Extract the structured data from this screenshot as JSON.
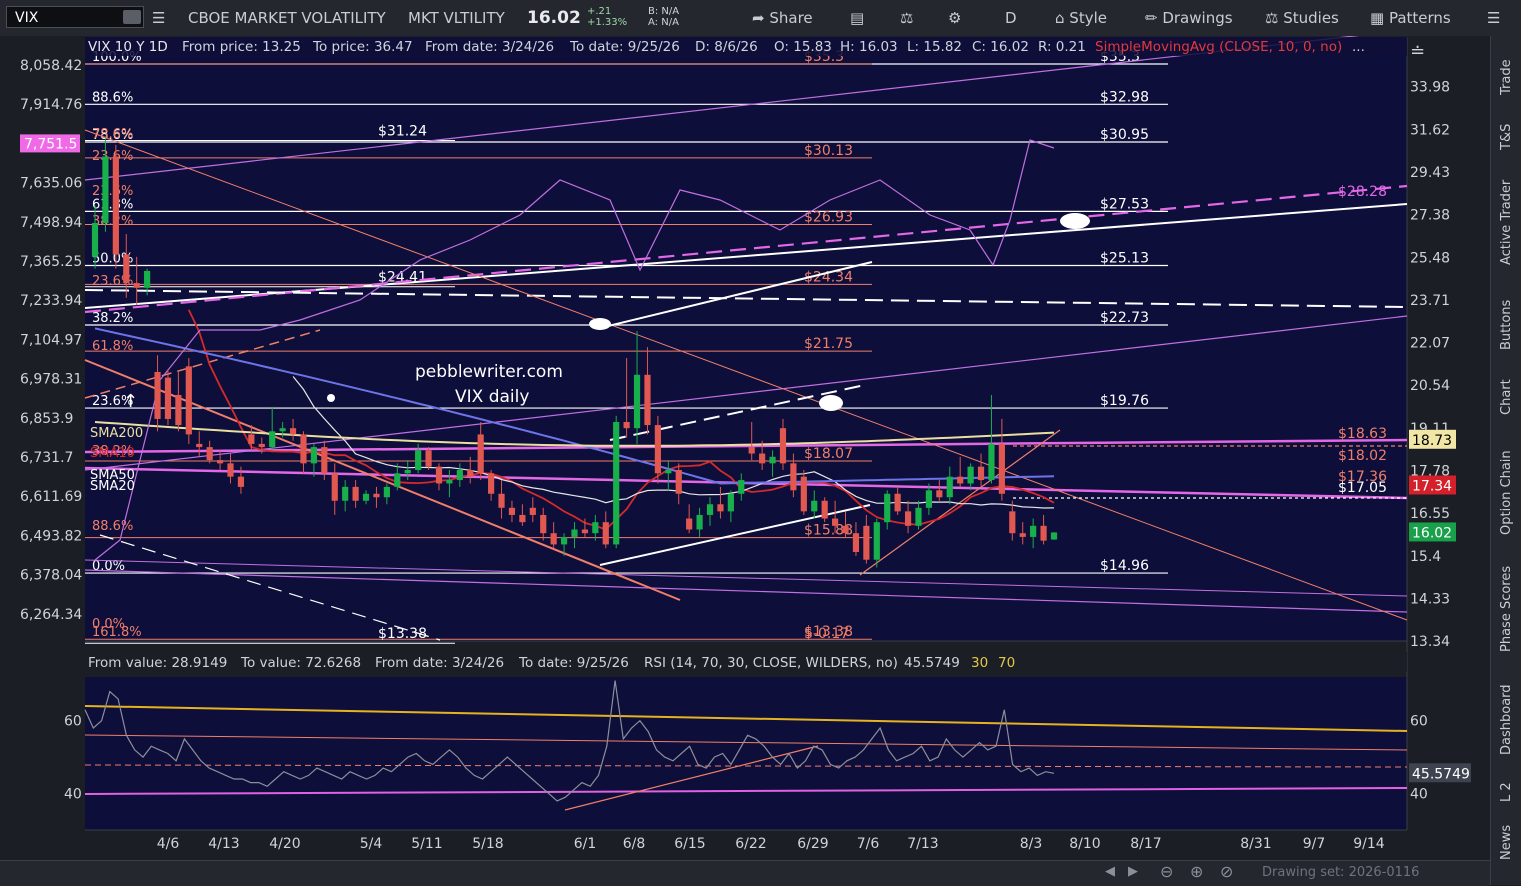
{
  "toolbar": {
    "symbol": "VIX",
    "name": "CBOE MARKET VOLATILITY",
    "short_name": "MKT VLTILITY",
    "last": "16.02",
    "change": "+.21",
    "change_pct": "+1.33%",
    "bid": "B: N/A",
    "ask": "A: N/A",
    "share": "Share",
    "period": "D",
    "style": "Style",
    "drawings": "Drawings",
    "studies": "Studies",
    "patterns": "Patterns"
  },
  "header": {
    "title": "VIX 10 Y 1D",
    "from_price": "From price: 13.25",
    "to_price": "To price: 36.47",
    "from_date": "From date: 3/24/26",
    "to_date": "To date: 9/25/26",
    "bar_date": "D: 8/6/26",
    "open": "O: 15.83",
    "high": "H: 16.03",
    "low": "L: 15.82",
    "close": "C: 16.02",
    "range": "R: 0.21",
    "study": "SimpleMovingAvg (CLOSE, 10, 0, no)",
    "more": "..."
  },
  "rsi_header": {
    "from_value": "From value: 28.9149",
    "to_value": "To value: 72.6268",
    "from_date": "From date: 3/24/26",
    "to_date": "To date: 9/25/26",
    "study": "RSI (14, 70, 30, CLOSE, WILDERS, no)",
    "value": "45.5749",
    "os": "30",
    "ob": "70"
  },
  "side_tabs": [
    "Trade",
    "T&S",
    "Active Trader",
    "Buttons",
    "Chart",
    "Option Chain",
    "Phase Scores",
    "Dashboard",
    "L 2",
    "News"
  ],
  "status": {
    "drawing_set": "Drawing set: 2026-0116"
  },
  "watermark": {
    "line1": "pebblewriter.com",
    "line2": "VIX daily"
  },
  "price_badges": [
    {
      "label": "18.73",
      "value": 18.73,
      "bg": "#f1e6a6",
      "fg": "#000000"
    },
    {
      "label": "17.34",
      "value": 17.34,
      "bg": "#d3202a",
      "fg": "#ffffff"
    },
    {
      "label": "16.02",
      "value": 16.02,
      "bg": "#18a04a",
      "fg": "#ffffff"
    }
  ],
  "left_badge": {
    "label": "7,751.5",
    "bg": "#f06ae8"
  },
  "colors": {
    "background": "#0e0e3a",
    "up": "#18b04a",
    "down": "#e0584f",
    "sma10": "#d32a2a",
    "sma20": "#e6e6e6",
    "sma50": "#6d74e8",
    "sma200": "#e9e0a0",
    "spx": "#c070e0",
    "fib": "#f07f6a",
    "rsi_upper": "#e5b320",
    "rsi_lower": "#e062e0"
  },
  "chart_data": [
    {
      "type": "candlestick",
      "title": "VIX 10 Y 1D",
      "ylim": [
        13.34,
        35.5
      ],
      "right_ticks": [
        "33.98",
        "31.62",
        "29.43",
        "27.38",
        "25.48",
        "23.71",
        "22.07",
        "20.54",
        "19.11",
        "17.78",
        "16.55",
        "15.4",
        "14.33",
        "13.34"
      ],
      "left_ticks": [
        "8,058.42",
        "7,914.76",
        "7,751.5",
        "7,635.06",
        "7,498.94",
        "7,365.25",
        "7,233.94",
        "7,104.97",
        "6,978.31",
        "6,853.9",
        "6,731.7",
        "6,611.69",
        "6,493.82",
        "6,378.04",
        "6,264.34"
      ],
      "x_ticks": [
        "4/6",
        "4/13",
        "4/20",
        "5/4",
        "5/11",
        "5/18",
        "6/1",
        "6/8",
        "6/15",
        "6/22",
        "6/29",
        "7/6",
        "7/13",
        "8/3",
        "8/10",
        "8/17",
        "8/31",
        "9/7",
        "9/14"
      ],
      "fib_left_labels": [
        "100.0%",
        "88.6%",
        "78.6%",
        "61.8%",
        "50.0%",
        "38.2%",
        "23.6%",
        "0.0%"
      ],
      "fib_left_values": [
        35.3,
        32.98,
        30.95,
        27.53,
        25.13,
        22.73,
        19.76,
        14.96
      ],
      "fib_right_labels": [
        "$35.3",
        "$32.98",
        "$30.95",
        "$27.53",
        "$25.13",
        "$22.73",
        "$19.76",
        "$14.96"
      ],
      "fib2_left_labels": [
        "78.6%",
        "23.6%",
        "23.6%",
        "38.2%",
        "23.6%",
        "61.8%",
        "38.2%",
        "88.6%",
        "0.0%",
        "161.8%"
      ],
      "fib2_right_labels": [
        "$35.3",
        "$30.13",
        "$26.93",
        "$24.34",
        "$21.75",
        "$18.07",
        "$15.88",
        "$13.38",
        "$-0.17"
      ],
      "fib2_values": [
        35.3,
        30.13,
        26.93,
        24.34,
        21.75,
        18.07,
        15.88,
        13.38
      ],
      "marks_left": [
        "$31.24",
        "$24.41",
        "$13.38"
      ],
      "mark_values": [
        31.24,
        24.41,
        13.38
      ],
      "right_line_labels": [
        "$28.28",
        "$18.63",
        "$18.02",
        "$17.36",
        "$17.05"
      ],
      "ma_labels": [
        "SMA200",
        "SMA10",
        "SMA50",
        "SMA20"
      ],
      "candles": [
        {
          "o": 25.5,
          "h": 27.8,
          "l": 25.0,
          "c": 27.0
        },
        {
          "o": 27.0,
          "h": 31.2,
          "l": 26.6,
          "c": 30.2
        },
        {
          "o": 30.2,
          "h": 30.8,
          "l": 25.0,
          "c": 25.6
        },
        {
          "o": 25.6,
          "h": 26.5,
          "l": 23.8,
          "c": 24.4
        },
        {
          "o": 24.4,
          "h": 25.5,
          "l": 23.5,
          "c": 24.2
        },
        {
          "o": 24.2,
          "h": 25.0,
          "l": 23.9,
          "c": 24.9
        },
        {
          "o": 21.0,
          "h": 21.6,
          "l": 19.0,
          "c": 19.4
        },
        {
          "o": 20.8,
          "h": 21.1,
          "l": 19.2,
          "c": 19.4
        },
        {
          "o": 20.2,
          "h": 21.0,
          "l": 19.0,
          "c": 19.2
        },
        {
          "o": 21.2,
          "h": 21.5,
          "l": 18.6,
          "c": 18.9
        },
        {
          "o": 18.6,
          "h": 19.0,
          "l": 18.2,
          "c": 18.5
        },
        {
          "o": 18.5,
          "h": 18.7,
          "l": 18.0,
          "c": 18.1
        },
        {
          "o": 18.1,
          "h": 18.4,
          "l": 17.8,
          "c": 18.0
        },
        {
          "o": 18.0,
          "h": 18.3,
          "l": 17.4,
          "c": 17.6
        },
        {
          "o": 17.6,
          "h": 17.9,
          "l": 17.1,
          "c": 17.3
        },
        {
          "o": 18.9,
          "h": 19.2,
          "l": 18.4,
          "c": 18.6
        },
        {
          "o": 18.6,
          "h": 18.8,
          "l": 18.3,
          "c": 18.5
        },
        {
          "o": 18.5,
          "h": 19.8,
          "l": 18.4,
          "c": 19.0
        },
        {
          "o": 19.0,
          "h": 19.3,
          "l": 18.8,
          "c": 19.1
        },
        {
          "o": 19.1,
          "h": 19.4,
          "l": 18.7,
          "c": 18.9
        },
        {
          "o": 18.9,
          "h": 19.0,
          "l": 17.7,
          "c": 18.0
        },
        {
          "o": 18.0,
          "h": 18.6,
          "l": 17.6,
          "c": 18.5
        },
        {
          "o": 18.5,
          "h": 18.7,
          "l": 17.5,
          "c": 17.7
        },
        {
          "o": 17.7,
          "h": 18.0,
          "l": 16.5,
          "c": 16.9
        },
        {
          "o": 16.9,
          "h": 17.5,
          "l": 16.6,
          "c": 17.3
        },
        {
          "o": 17.3,
          "h": 17.5,
          "l": 16.7,
          "c": 16.9
        },
        {
          "o": 16.9,
          "h": 17.2,
          "l": 16.8,
          "c": 17.1
        },
        {
          "o": 17.1,
          "h": 17.3,
          "l": 16.7,
          "c": 17.0
        },
        {
          "o": 17.0,
          "h": 17.4,
          "l": 16.8,
          "c": 17.3
        },
        {
          "o": 17.3,
          "h": 18.0,
          "l": 17.2,
          "c": 17.7
        },
        {
          "o": 17.7,
          "h": 18.1,
          "l": 17.5,
          "c": 17.8
        },
        {
          "o": 17.8,
          "h": 18.6,
          "l": 17.7,
          "c": 18.4
        },
        {
          "o": 18.4,
          "h": 18.5,
          "l": 17.8,
          "c": 17.9
        },
        {
          "o": 17.9,
          "h": 18.0,
          "l": 17.2,
          "c": 17.4
        },
        {
          "o": 17.4,
          "h": 17.8,
          "l": 17.0,
          "c": 17.5
        },
        {
          "o": 17.5,
          "h": 18.0,
          "l": 17.3,
          "c": 17.8
        },
        {
          "o": 17.8,
          "h": 18.2,
          "l": 17.4,
          "c": 17.6
        },
        {
          "o": 18.9,
          "h": 19.3,
          "l": 17.5,
          "c": 17.7
        },
        {
          "o": 17.7,
          "h": 17.8,
          "l": 16.9,
          "c": 17.1
        },
        {
          "o": 17.1,
          "h": 17.5,
          "l": 16.4,
          "c": 16.7
        },
        {
          "o": 16.7,
          "h": 16.9,
          "l": 16.3,
          "c": 16.5
        },
        {
          "o": 16.5,
          "h": 16.8,
          "l": 16.2,
          "c": 16.3
        },
        {
          "o": 16.7,
          "h": 17.0,
          "l": 16.3,
          "c": 16.5
        },
        {
          "o": 16.5,
          "h": 16.7,
          "l": 15.8,
          "c": 16.0
        },
        {
          "o": 16.0,
          "h": 16.3,
          "l": 15.6,
          "c": 15.7
        },
        {
          "o": 15.7,
          "h": 16.0,
          "l": 15.4,
          "c": 15.9
        },
        {
          "o": 15.9,
          "h": 16.3,
          "l": 15.6,
          "c": 16.1
        },
        {
          "o": 16.1,
          "h": 16.4,
          "l": 15.9,
          "c": 16.0
        },
        {
          "o": 16.0,
          "h": 16.5,
          "l": 15.8,
          "c": 16.3
        },
        {
          "o": 16.3,
          "h": 16.6,
          "l": 15.6,
          "c": 15.7
        },
        {
          "o": 15.7,
          "h": 19.5,
          "l": 15.6,
          "c": 19.3
        },
        {
          "o": 19.3,
          "h": 21.5,
          "l": 18.8,
          "c": 19.1
        },
        {
          "o": 19.1,
          "h": 22.5,
          "l": 18.6,
          "c": 20.9
        },
        {
          "o": 20.9,
          "h": 21.9,
          "l": 18.9,
          "c": 19.2
        },
        {
          "o": 19.2,
          "h": 19.5,
          "l": 17.4,
          "c": 17.7
        },
        {
          "o": 17.7,
          "h": 18.1,
          "l": 17.2,
          "c": 17.8
        },
        {
          "o": 17.8,
          "h": 18.0,
          "l": 16.8,
          "c": 17.1
        },
        {
          "o": 16.4,
          "h": 16.8,
          "l": 16.0,
          "c": 16.1
        },
        {
          "o": 16.1,
          "h": 16.7,
          "l": 15.9,
          "c": 16.5
        },
        {
          "o": 16.5,
          "h": 17.0,
          "l": 16.2,
          "c": 16.8
        },
        {
          "o": 16.8,
          "h": 17.3,
          "l": 16.4,
          "c": 16.6
        },
        {
          "o": 16.6,
          "h": 17.2,
          "l": 16.3,
          "c": 17.1
        },
        {
          "o": 17.1,
          "h": 17.7,
          "l": 16.9,
          "c": 17.5
        },
        {
          "o": 18.5,
          "h": 19.3,
          "l": 18.1,
          "c": 18.3
        },
        {
          "o": 18.3,
          "h": 18.7,
          "l": 17.8,
          "c": 18.0
        },
        {
          "o": 18.0,
          "h": 18.4,
          "l": 17.6,
          "c": 18.2
        },
        {
          "o": 19.1,
          "h": 19.4,
          "l": 17.8,
          "c": 18.0
        },
        {
          "o": 18.0,
          "h": 18.3,
          "l": 17.0,
          "c": 17.2
        },
        {
          "o": 17.6,
          "h": 17.8,
          "l": 16.5,
          "c": 16.6
        },
        {
          "o": 16.6,
          "h": 17.2,
          "l": 16.4,
          "c": 16.9
        },
        {
          "o": 16.9,
          "h": 17.0,
          "l": 16.3,
          "c": 16.4
        },
        {
          "o": 16.4,
          "h": 16.9,
          "l": 16.0,
          "c": 16.2
        },
        {
          "o": 16.2,
          "h": 16.6,
          "l": 15.9,
          "c": 16.0
        },
        {
          "o": 16.0,
          "h": 16.3,
          "l": 15.4,
          "c": 15.5
        },
        {
          "o": 16.2,
          "h": 16.5,
          "l": 15.2,
          "c": 15.3
        },
        {
          "o": 15.3,
          "h": 16.4,
          "l": 15.1,
          "c": 16.3
        },
        {
          "o": 16.3,
          "h": 17.2,
          "l": 16.1,
          "c": 17.1
        },
        {
          "o": 17.1,
          "h": 17.3,
          "l": 16.5,
          "c": 16.6
        },
        {
          "o": 16.6,
          "h": 16.9,
          "l": 16.0,
          "c": 16.2
        },
        {
          "o": 16.2,
          "h": 16.9,
          "l": 16.1,
          "c": 16.7
        },
        {
          "o": 16.7,
          "h": 17.4,
          "l": 16.5,
          "c": 17.2
        },
        {
          "o": 17.2,
          "h": 17.5,
          "l": 16.9,
          "c": 17.0
        },
        {
          "o": 17.0,
          "h": 17.9,
          "l": 16.8,
          "c": 17.6
        },
        {
          "o": 17.6,
          "h": 18.2,
          "l": 17.3,
          "c": 17.4
        },
        {
          "o": 17.4,
          "h": 18.0,
          "l": 17.2,
          "c": 17.9
        },
        {
          "o": 17.9,
          "h": 18.3,
          "l": 17.3,
          "c": 17.5
        },
        {
          "o": 17.5,
          "h": 20.2,
          "l": 17.4,
          "c": 18.6
        },
        {
          "o": 18.6,
          "h": 19.4,
          "l": 16.9,
          "c": 17.1
        },
        {
          "o": 16.6,
          "h": 16.9,
          "l": 15.8,
          "c": 16.0
        },
        {
          "o": 16.0,
          "h": 16.3,
          "l": 15.7,
          "c": 15.9
        },
        {
          "o": 15.9,
          "h": 16.4,
          "l": 15.6,
          "c": 16.2
        },
        {
          "o": 16.2,
          "h": 16.5,
          "l": 15.7,
          "c": 15.8
        },
        {
          "o": 15.83,
          "h": 16.03,
          "l": 15.82,
          "c": 16.02
        }
      ]
    },
    {
      "type": "line",
      "title": "RSI (14, 70, 30, CLOSE, WILDERS, no)",
      "ylim": [
        30,
        72
      ],
      "ticks": [
        "60",
        "40"
      ],
      "last_value": 45.5749,
      "values": [
        63,
        58,
        60,
        68,
        66,
        56,
        52,
        50,
        53,
        52,
        51,
        49,
        55,
        52,
        49,
        47,
        46,
        45,
        44,
        44,
        43,
        43,
        42,
        44,
        46,
        45,
        44,
        45,
        47,
        46,
        45,
        44,
        46,
        45,
        44,
        45,
        47,
        46,
        48,
        50,
        51,
        49,
        48,
        50,
        52,
        50,
        47,
        45,
        44,
        46,
        48,
        50,
        48,
        46,
        44,
        42,
        40,
        38,
        39,
        41,
        43,
        42,
        45,
        53,
        71,
        55,
        58,
        60,
        57,
        52,
        50,
        49,
        51,
        53,
        48,
        47,
        50,
        51,
        48,
        52,
        56,
        55,
        53,
        50,
        48,
        51,
        47,
        49,
        53,
        52,
        48,
        47,
        49,
        50,
        52,
        55,
        58,
        52,
        49,
        50,
        51,
        53,
        49,
        50,
        55,
        52,
        50,
        52,
        54,
        52,
        53,
        63,
        48,
        46,
        47,
        45,
        46,
        45.57
      ]
    }
  ]
}
